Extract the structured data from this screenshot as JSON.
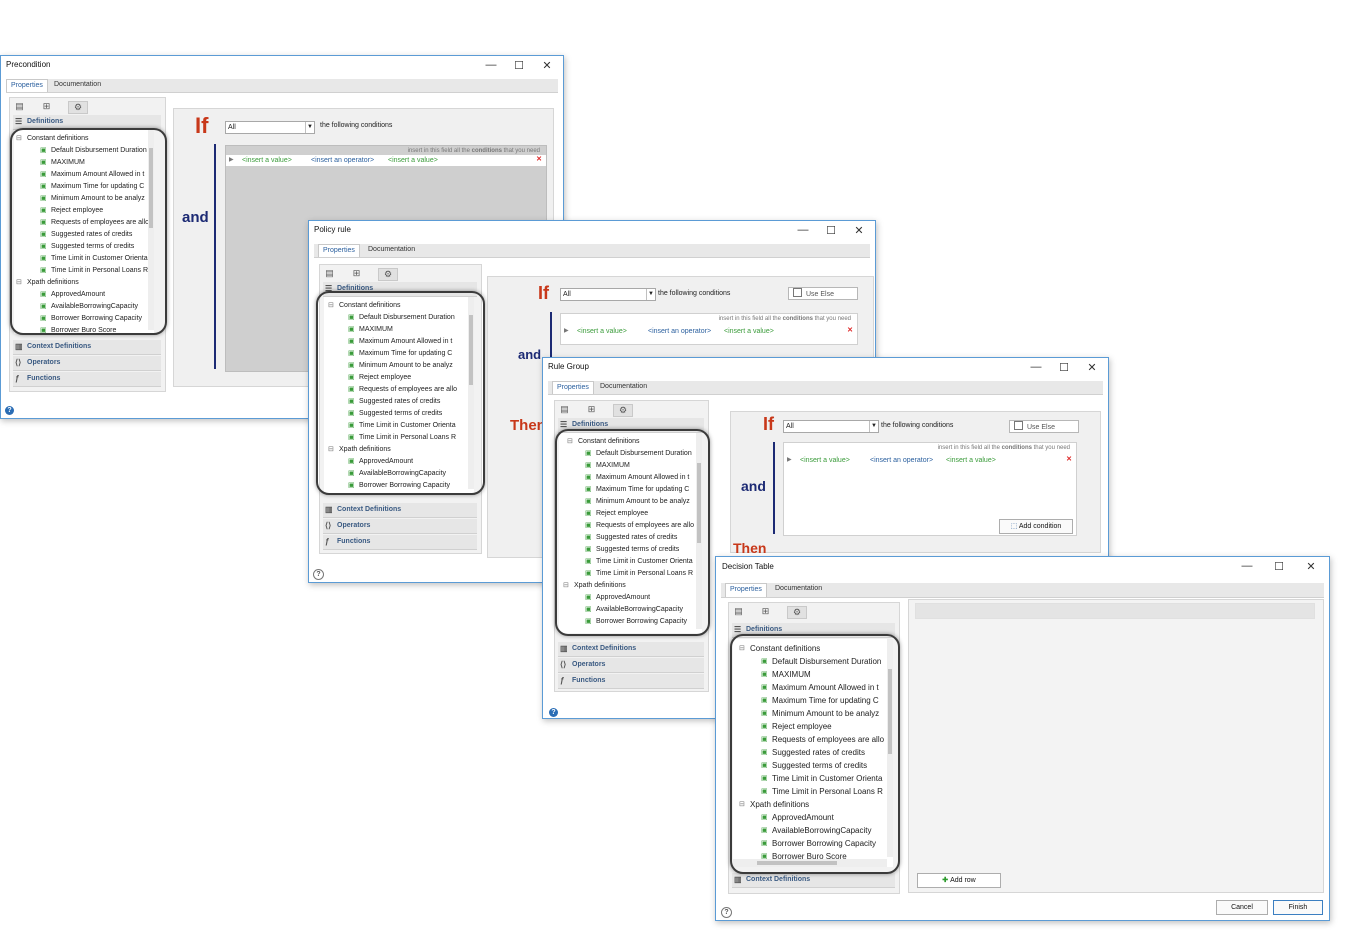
{
  "tree_items": {
    "constant_header": "Constant definitions",
    "c1": "Default Disbursement Duration",
    "c2": "MAXIMUM",
    "c3": "Maximum Amount Allowed in t",
    "c4": "Maximum Time for updating C",
    "c5": "Minimum Amount to be analyz",
    "c6": "Reject employee",
    "c7": "Requests of employees are allo",
    "c8": "Suggested rates of credits",
    "c9": "Suggested terms of credits",
    "c10": "Time Limit in Customer Orienta",
    "c11": "Time Limit in Personal Loans R",
    "xpath_header": "Xpath definitions",
    "x1": "ApprovedAmount",
    "x2": "AvailableBorrowingCapacity",
    "x3": "Borrower Borrowing Capacity",
    "x4": "Borrower Buro Score"
  },
  "sections": {
    "definitions": "Definitions",
    "context": "Context Definitions",
    "operators": "Operators",
    "functions": "Functions"
  },
  "tabs": {
    "properties": "Properties",
    "documentation": "Documentation"
  },
  "rule": {
    "if": "If",
    "all": "All",
    "following": "the following conditions",
    "and": "and",
    "then": "Then",
    "hint_pre": "insert in this field all the",
    "hint_bold": "conditions",
    "hint_post": "that you need",
    "insert_value": "<insert a value>",
    "insert_operator": "<insert an operator>",
    "use_else": "Use Else",
    "add_condition": "Add condition"
  },
  "windows": {
    "precondition": {
      "title": "Precondition"
    },
    "policy": {
      "title": "Policy rule"
    },
    "group": {
      "title": "Rule Group"
    },
    "decision": {
      "title": "Decision Table",
      "add_row": "Add row",
      "cancel": "Cancel",
      "finish": "Finish"
    }
  },
  "window_controls": {
    "minimize": "—",
    "maximize": "☐",
    "close": "✕"
  },
  "colors": {
    "accent": "#5b9bd5",
    "if": "#c8381a",
    "and": "#1c2a74",
    "value": "#3a9b3a",
    "operator": "#2a5f9e"
  }
}
